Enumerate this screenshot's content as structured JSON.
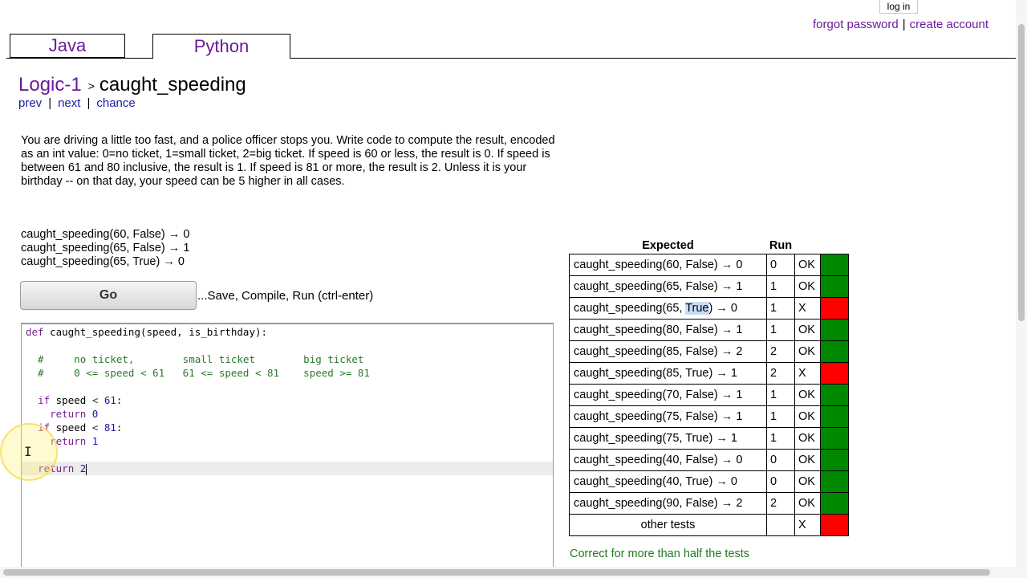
{
  "account": {
    "login_label": "log in",
    "forgot_label": "forgot password",
    "separator": "|",
    "create_label": "create account"
  },
  "tabs": {
    "java": "Java",
    "python": "Python"
  },
  "breadcrumb": {
    "section": "Logic-1",
    "separator": ">",
    "problem": "caught_speeding"
  },
  "nav": {
    "prev": "prev",
    "next": "next",
    "chance": "chance",
    "separator": "|"
  },
  "description": "You are driving a little too fast, and a police officer stops you. Write code to compute the result, encoded as an int value: 0=no ticket, 1=small ticket, 2=big ticket. If speed is 60 or less, the result is 0. If speed is between 61 and 80 inclusive, the result is 1. If speed is 81 or more, the result is 2. Unless it is your birthday -- on that day, your speed can be 5 higher in all cases.",
  "examples": [
    "caught_speeding(60, False) → 0",
    "caught_speeding(65, False) → 1",
    "caught_speeding(65, True) → 0"
  ],
  "go": {
    "label": "Go",
    "hint": "...Save, Compile, Run (ctrl-enter)"
  },
  "code": {
    "line1": {
      "kw": "def",
      "rest": " caught_speeding(speed, is_birthday):"
    },
    "line2": "",
    "comment1": "  #     no ticket,        small ticket        big ticket",
    "comment2": "  #     0 <= speed < 61   61 <= speed < 81    speed >= 81",
    "line5": "",
    "if1": {
      "indent": "  ",
      "kw": "if",
      "var": " speed ",
      "op": "<",
      "num": " 61",
      "colon": ":"
    },
    "ret0": {
      "indent": "    ",
      "kw": "return",
      "num": " 0"
    },
    "if2": {
      "indent": "  ",
      "kw": "if",
      "var": " speed ",
      "op": "<",
      "num": " 81",
      "colon": ":"
    },
    "ret1": {
      "indent": "    ",
      "kw": "return",
      "num": " 1"
    },
    "line10": "",
    "ret2": {
      "indent": "  ",
      "kw": "return",
      "num": " 2"
    }
  },
  "results": {
    "headers": {
      "expected": "Expected",
      "run": "Run"
    },
    "rows": [
      {
        "call": "caught_speeding(60, False) → 0",
        "run": "0",
        "result": "OK"
      },
      {
        "call_pre": "caught_speeding(65, ",
        "call_sel": "True",
        "call_post": ") → 0",
        "run": "1",
        "result": "X"
      },
      {
        "call": "caught_speeding(65, False) → 1",
        "run": "1",
        "result": "OK"
      },
      {
        "call": "caught_speeding(80, False) → 1",
        "run": "1",
        "result": "OK"
      },
      {
        "call": "caught_speeding(85, False) → 2",
        "run": "2",
        "result": "OK"
      },
      {
        "call": "caught_speeding(85, True) → 1",
        "run": "2",
        "result": "X"
      },
      {
        "call": "caught_speeding(70, False) → 1",
        "run": "1",
        "result": "OK"
      },
      {
        "call": "caught_speeding(75, False) → 1",
        "run": "1",
        "result": "OK"
      },
      {
        "call": "caught_speeding(75, True) → 1",
        "run": "1",
        "result": "OK"
      },
      {
        "call": "caught_speeding(40, False) → 0",
        "run": "0",
        "result": "OK"
      },
      {
        "call": "caught_speeding(40, True) → 0",
        "run": "0",
        "result": "OK"
      },
      {
        "call": "caught_speeding(90, False) → 2",
        "run": "2",
        "result": "OK"
      },
      {
        "call": "other tests",
        "run": "",
        "result": "X"
      }
    ],
    "colors": {
      "pass": "#008800",
      "fail": "#ff0000"
    }
  },
  "summary": "Correct for more than half the tests"
}
